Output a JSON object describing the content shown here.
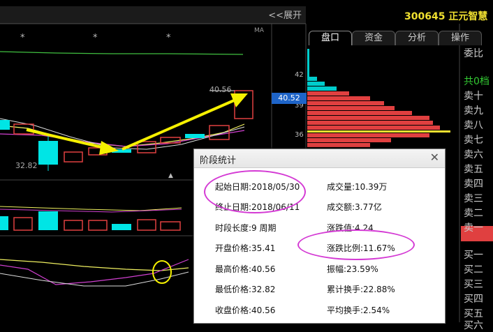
{
  "header": {
    "expand_label": "<<展开",
    "stock_code": "300645",
    "stock_name": "正元智慧"
  },
  "tabs": [
    {
      "label": "盘口",
      "active": true
    },
    {
      "label": "资金",
      "active": false
    },
    {
      "label": "分析",
      "active": false
    },
    {
      "label": "操作",
      "active": false
    }
  ],
  "chart": {
    "ma_label": "MA",
    "high_label": "40.56",
    "low_label": "32.82"
  },
  "order_book": {
    "ticks": [
      "42",
      "39",
      "36"
    ],
    "current_price": "40.52"
  },
  "depth_list": {
    "ratio_label": "委比",
    "total_label": "共0档",
    "items": [
      "卖十",
      "卖九",
      "卖八",
      "卖七",
      "卖六",
      "卖五",
      "卖四",
      "卖三",
      "卖二",
      "卖一",
      "买一",
      "买二",
      "买三",
      "买四",
      "买五",
      "买六"
    ]
  },
  "dialog": {
    "title": "阶段统计",
    "close_glyph": "✕",
    "left": [
      {
        "label": "起始日期:",
        "value": "2018/05/30"
      },
      {
        "label": "终止日期:",
        "value": "2018/06/11"
      },
      {
        "label": "时段长度:",
        "value": "9 周期"
      },
      {
        "label": "开盘价格:",
        "value": "35.41"
      },
      {
        "label": "最高价格:",
        "value": "40.56"
      },
      {
        "label": "最低价格:",
        "value": "32.82"
      },
      {
        "label": "收盘价格:",
        "value": "40.56"
      }
    ],
    "right": [
      {
        "label": "成交量:",
        "value": "10.39万"
      },
      {
        "label": "成交额:",
        "value": "3.77亿"
      },
      {
        "label": "涨跌值:",
        "value": "4.24"
      },
      {
        "label": "涨跌比例:",
        "value": "11.67%"
      },
      {
        "label": "振幅:",
        "value": "23.59%"
      },
      {
        "label": "累计换手:",
        "value": "22.88%"
      },
      {
        "label": "平均换手:",
        "value": "2.54%"
      }
    ]
  },
  "colors": {
    "up": "#e04040",
    "down": "#00e5e5",
    "ma_yellow": "#f0f060",
    "ma_magenta": "#d040d0",
    "ma_green": "#40c040",
    "annotation_yellow": "#f5f000",
    "annotation_magenta": "#d43ad4"
  }
}
